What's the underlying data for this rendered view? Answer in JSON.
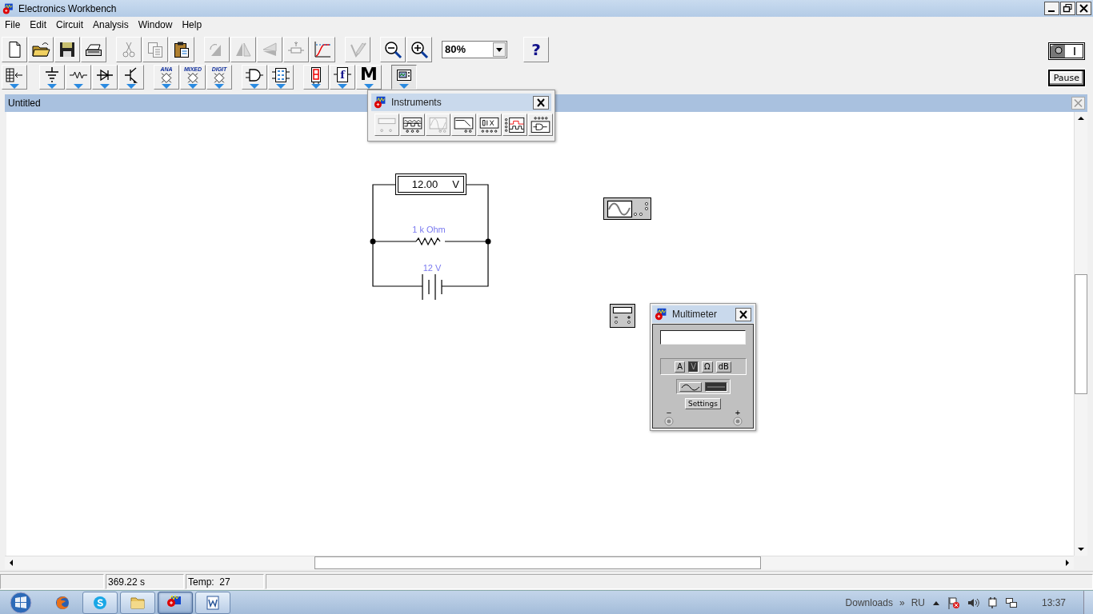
{
  "window": {
    "title": "Electronics Workbench"
  },
  "menu": [
    "File",
    "Edit",
    "Circuit",
    "Analysis",
    "Window",
    "Help"
  ],
  "toolbar_groups": [
    [
      {
        "kind": "new",
        "disabled": false
      },
      {
        "kind": "open",
        "disabled": false
      },
      {
        "kind": "save",
        "disabled": false
      },
      {
        "kind": "print",
        "disabled": false
      }
    ],
    [
      {
        "kind": "cut",
        "disabled": true
      },
      {
        "kind": "copy",
        "disabled": true
      },
      {
        "kind": "paste",
        "disabled": false
      }
    ],
    [
      {
        "kind": "rotate",
        "disabled": true
      },
      {
        "kind": "flip-h",
        "disabled": true
      },
      {
        "kind": "flip-v",
        "disabled": true
      },
      {
        "kind": "properties",
        "disabled": true
      },
      {
        "kind": "graph",
        "disabled": false
      }
    ],
    [
      {
        "kind": "description",
        "disabled": true
      }
    ],
    [
      {
        "kind": "zoom-out",
        "disabled": false
      },
      {
        "kind": "zoom-in",
        "disabled": false
      }
    ]
  ],
  "zoom": {
    "value": "80%"
  },
  "help_button": "?",
  "parts_bin_groups": [
    [
      {
        "kind": "favorites",
        "selected": false
      }
    ],
    [
      {
        "kind": "sources",
        "selected": false
      },
      {
        "kind": "basic",
        "selected": false
      },
      {
        "kind": "diodes",
        "selected": false
      },
      {
        "kind": "transistors",
        "selected": false
      }
    ],
    [
      {
        "kind": "chip",
        "label": "ANA",
        "selected": false
      },
      {
        "kind": "chip",
        "label": "MIXED",
        "selected": false
      },
      {
        "kind": "chip",
        "label": "DIGIT",
        "selected": false
      }
    ],
    [
      {
        "kind": "gates",
        "selected": false
      },
      {
        "kind": "digital",
        "selected": false
      }
    ],
    [
      {
        "kind": "indicators",
        "selected": false
      },
      {
        "kind": "controls",
        "label": "f",
        "selected": false
      },
      {
        "kind": "misc",
        "label": "M",
        "selected": false
      }
    ],
    [
      {
        "kind": "instruments",
        "selected": true
      }
    ]
  ],
  "power_switch": {
    "on": false
  },
  "pause_button": "Pause",
  "document": {
    "title": "Untitled"
  },
  "circuit": {
    "voltmeter": {
      "reading": "12.00",
      "unit": "V"
    },
    "resistor": {
      "label": "1 k Ohm"
    },
    "battery": {
      "label": "12 V"
    }
  },
  "instruments_palette": {
    "title": "Instruments",
    "buttons": [
      {
        "kind": "multimeter",
        "disabled": true
      },
      {
        "kind": "function-generator",
        "disabled": false
      },
      {
        "kind": "oscilloscope",
        "disabled": true
      },
      {
        "kind": "bode-plotter",
        "disabled": false
      },
      {
        "kind": "word-generator",
        "disabled": false
      },
      {
        "kind": "logic-analyzer",
        "disabled": false
      },
      {
        "kind": "logic-converter",
        "disabled": false
      }
    ]
  },
  "multimeter": {
    "title": "Multimeter",
    "modes": [
      {
        "label": "A",
        "selected": false
      },
      {
        "label": "V",
        "selected": true
      },
      {
        "label": "Ω",
        "selected": false
      },
      {
        "label": "dB",
        "selected": false
      }
    ],
    "signals": [
      {
        "kind": "ac",
        "selected": false
      },
      {
        "kind": "dc",
        "selected": true
      }
    ],
    "settings": "Settings",
    "terminals": [
      "−",
      "+"
    ]
  },
  "status_bar": [
    "369.22 s",
    "Temp:  27"
  ],
  "taskbar": {
    "apps": [
      {
        "kind": "browser",
        "running": false,
        "active": false
      },
      {
        "kind": "messenger",
        "running": true,
        "active": false
      },
      {
        "kind": "folder",
        "running": true,
        "active": false
      },
      {
        "kind": "workbench",
        "running": true,
        "active": true
      },
      {
        "kind": "word",
        "running": true,
        "active": false
      }
    ],
    "tray": {
      "downloads": "Downloads",
      "chevron": "»",
      "language": "RU",
      "clock": "13:37"
    }
  }
}
